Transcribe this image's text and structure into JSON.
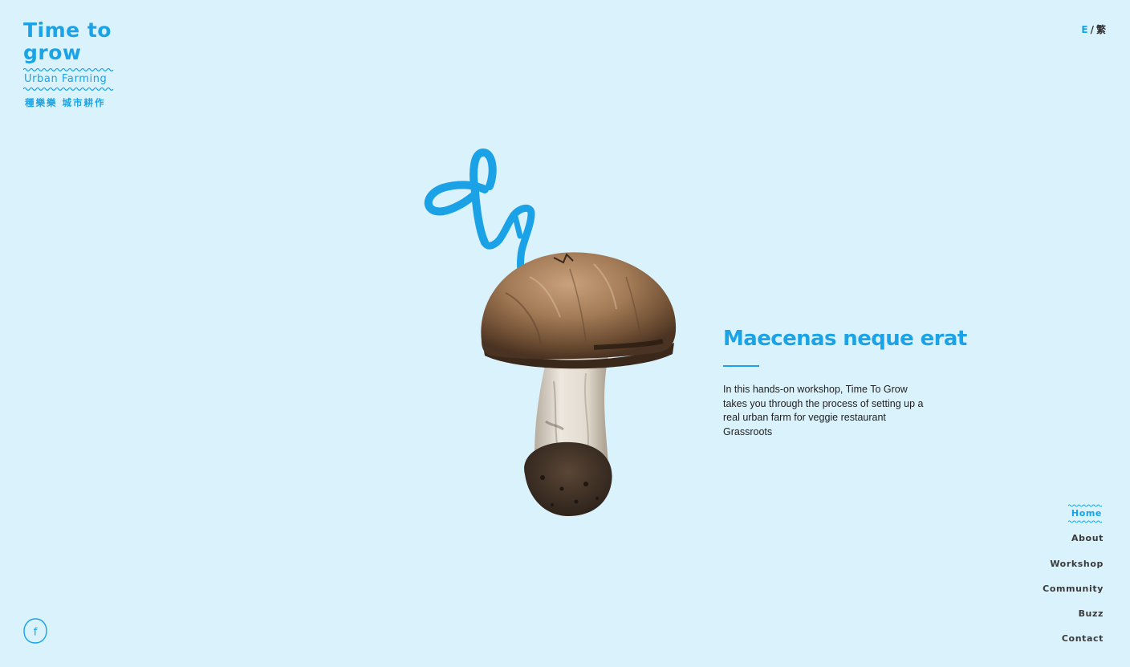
{
  "logo": {
    "title": "Time to grow",
    "subtitle": "Urban Farming",
    "chinese": "種樂樂 城市耕作"
  },
  "language": {
    "english": "E",
    "separator": "/",
    "chinese": "繁"
  },
  "hero": {
    "title": "Maecenas neque erat",
    "description": "In this hands-on workshop, Time To Grow takes you through the process of setting up a real urban farm for veggie restaurant Grassroots"
  },
  "nav": {
    "items": [
      {
        "label": "Home",
        "active": true
      },
      {
        "label": "About",
        "active": false
      },
      {
        "label": "Workshop",
        "active": false
      },
      {
        "label": "Community",
        "active": false
      },
      {
        "label": "Buzz",
        "active": false
      },
      {
        "label": "Contact",
        "active": false
      }
    ]
  },
  "social": {
    "facebook_glyph": "f",
    "icon": "facebook-icon"
  },
  "colors": {
    "background": "#daf2fc",
    "accent": "#1aa3e6",
    "text": "#1f1f1f",
    "nav_text": "#3a3a3a"
  }
}
